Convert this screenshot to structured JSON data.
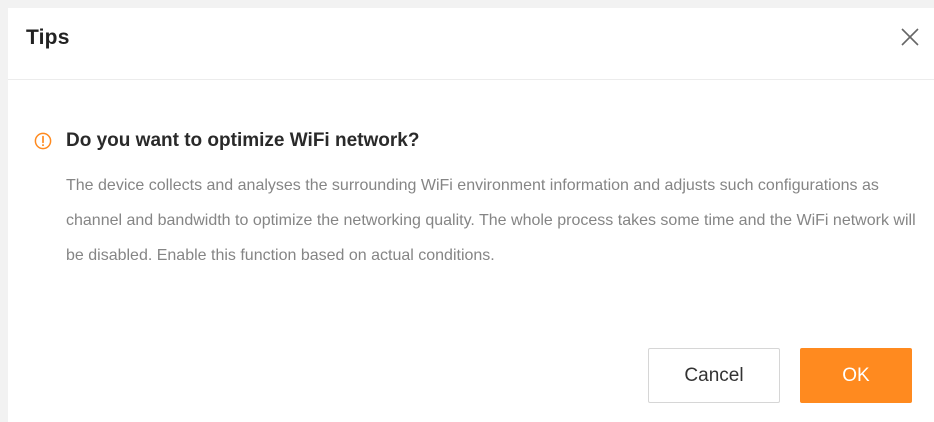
{
  "dialog": {
    "title": "Tips",
    "close_icon": "close-icon",
    "warning_icon": "exclamation-circle-icon",
    "question": "Do you want to optimize WiFi network?",
    "description": "The device collects and analyses the surrounding WiFi environment information and adjusts such configurations as channel and bandwidth to optimize the networking quality. The whole process takes some time and the WiFi network will be disabled. Enable this function based on actual conditions.",
    "cancel_label": "Cancel",
    "ok_label": "OK"
  },
  "colors": {
    "accent": "#ff8a1f",
    "warning": "#ff8a1f",
    "title_text": "#222222",
    "body_text": "#858585",
    "background": "#ffffff"
  }
}
